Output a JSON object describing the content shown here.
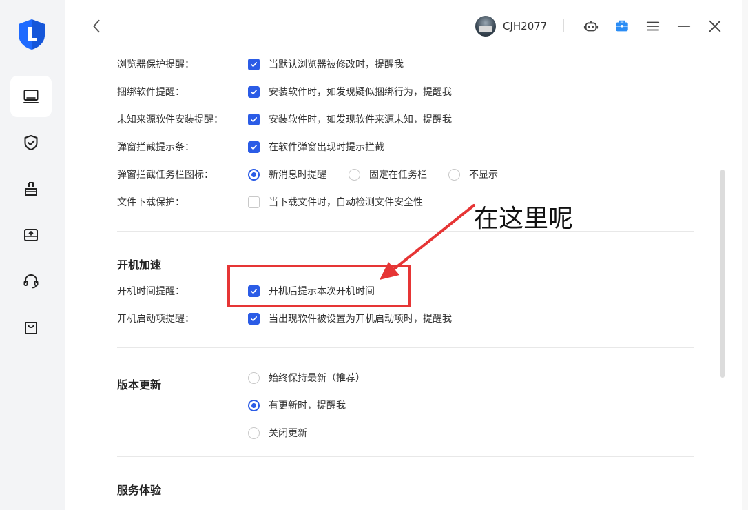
{
  "header": {
    "username": "CJH2077"
  },
  "sidebar": {
    "items": [
      {
        "name": "computer-icon",
        "active": true
      },
      {
        "name": "shield-check-icon",
        "active": false
      },
      {
        "name": "broom-icon",
        "active": false
      },
      {
        "name": "software-box-icon",
        "active": false
      },
      {
        "name": "headset-icon",
        "active": false
      },
      {
        "name": "shopping-bag-icon",
        "active": false
      }
    ]
  },
  "settings": {
    "rows": [
      {
        "label": "浏览器保护提醒：",
        "option": "当默认浏览器被修改时，提醒我",
        "checked": true
      },
      {
        "label": "捆绑软件提醒：",
        "option": "安装软件时，如发现疑似捆绑行为，提醒我",
        "checked": true
      },
      {
        "label": "未知来源软件安装提醒：",
        "option": "安装软件时，如发现软件来源未知，提醒我",
        "checked": true
      },
      {
        "label": "弹窗拦截提示条：",
        "option": "在软件弹窗出现时提示拦截",
        "checked": true
      },
      {
        "label": "弹窗拦截任务栏图标：",
        "radios": [
          "新消息时提醒",
          "固定在任务栏",
          "不显示"
        ],
        "selected": 0
      },
      {
        "label": "文件下载保护：",
        "option": "当下载文件时，自动检测文件安全性",
        "checked": false
      }
    ],
    "boot": {
      "title": "开机加速",
      "rows": [
        {
          "label": "开机时间提醒：",
          "option": "开机后提示本次开机时间",
          "checked": true
        },
        {
          "label": "开机启动项提醒：",
          "option": "当出现软件被设置为开机启动项时，提醒我",
          "checked": true
        }
      ]
    },
    "update": {
      "title": "版本更新",
      "options": [
        "始终保持最新（推荐）",
        "有更新时，提醒我",
        "关闭更新"
      ],
      "selected": 1
    },
    "service": {
      "title": "服务体验"
    }
  },
  "annotation": {
    "text": "在这里呢",
    "color": "#e63535"
  },
  "colors": {
    "accent": "#2b5ce6",
    "logo": "#1f6bff"
  }
}
